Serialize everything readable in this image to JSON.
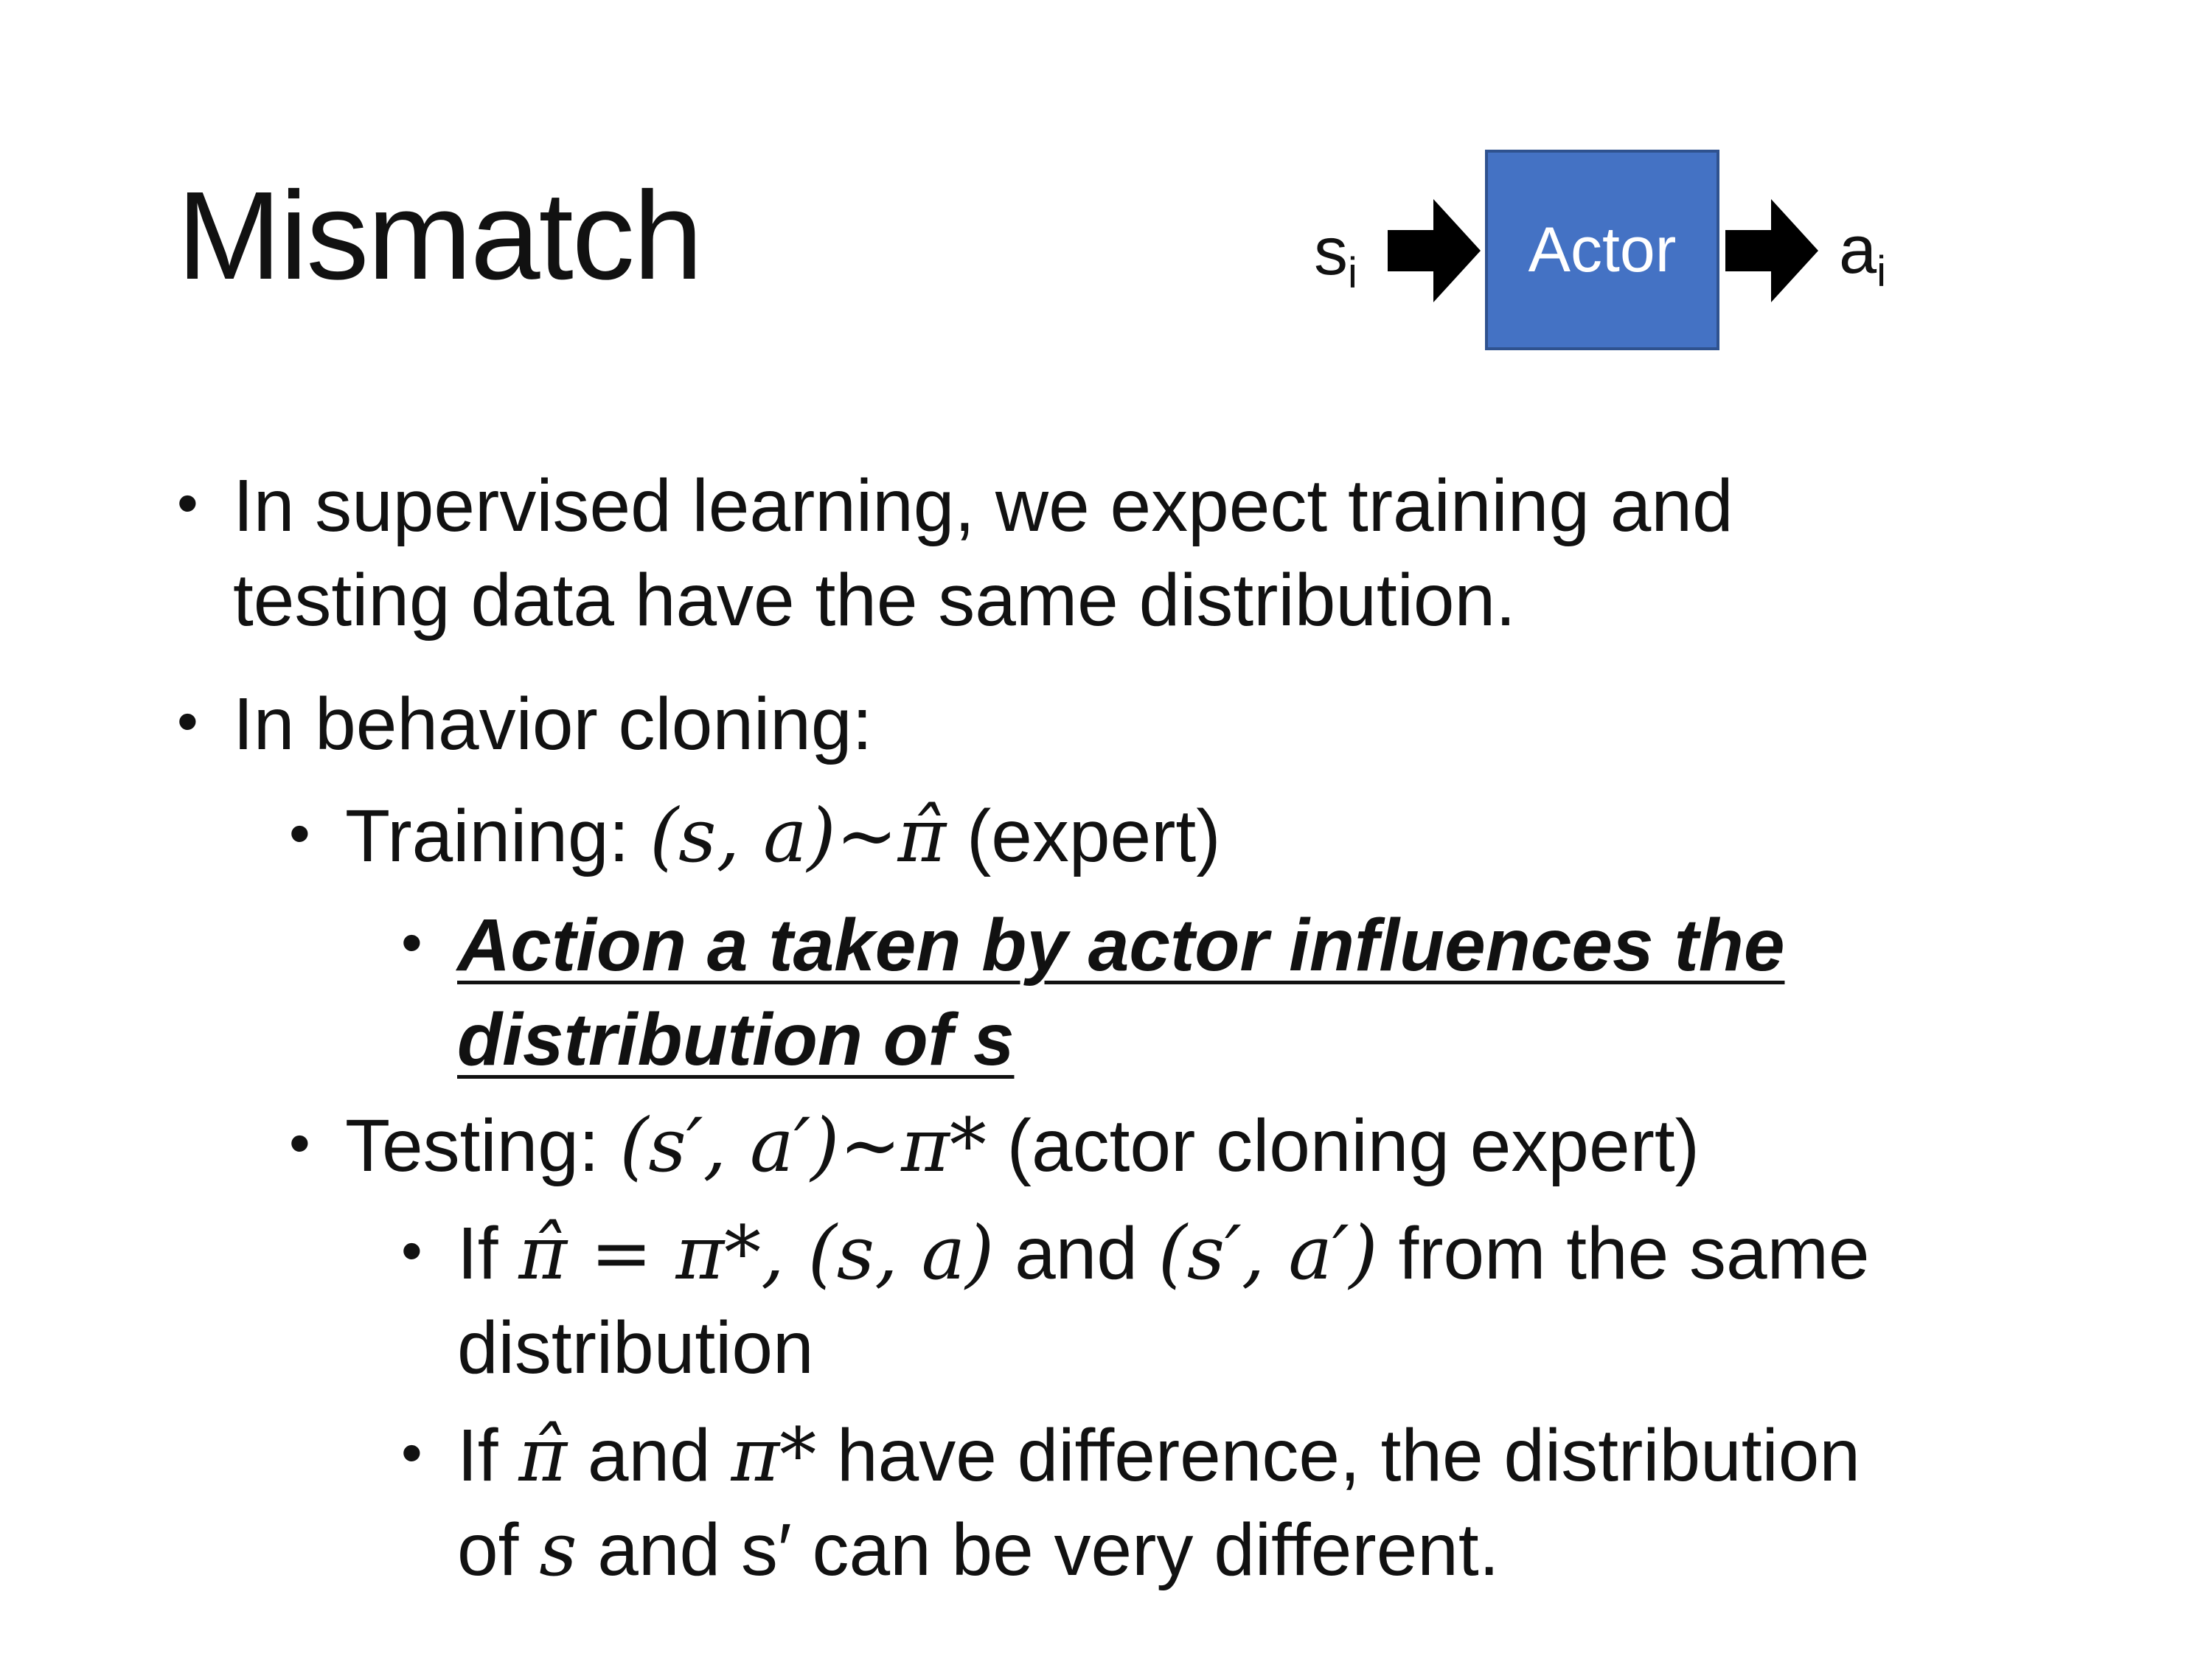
{
  "slide": {
    "title": "Mismatch",
    "diagram": {
      "input_var": "s",
      "input_sub": "i",
      "box_label": "Actor",
      "output_var": "a",
      "output_sub": "i",
      "box_color": "#4472c4"
    },
    "bullets": {
      "b1_line1": "In supervised learning, we expect training and",
      "b1_line2": "testing data have the same distribution.",
      "b2": "In behavior cloning:",
      "training_label": "Training: ",
      "training_math": "(s, a)~π̂",
      "training_note": " (expert)",
      "action_line1": "Action a taken by actor influences the",
      "action_line2": "distribution of s",
      "testing_label": "Testing: ",
      "testing_math": "(s′, a′)~π*",
      "testing_note": " (actor cloning expert)",
      "if1_prefix": "If ",
      "if1_math1": "π̂ = π*, (s, a)",
      "if1_mid": " and ",
      "if1_math2": "(s′, a′)",
      "if1_suffix": " from the same",
      "if1_line2": "distribution",
      "if2_prefix": "If ",
      "if2_math1": "π̂",
      "if2_mid": " and ",
      "if2_math2": "π*",
      "if2_suffix": " have difference, the distribution",
      "if2_of": "of ",
      "if2_math3": "s",
      "if2_rest": " and s′ can be very different."
    }
  }
}
